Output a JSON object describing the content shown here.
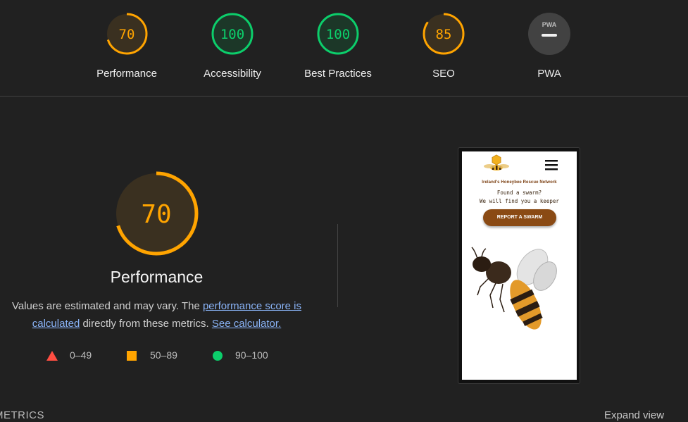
{
  "scores": [
    {
      "key": "performance",
      "value": "70",
      "score": 70,
      "label": "Performance",
      "color": "#ffa400",
      "bg": "#3a3020"
    },
    {
      "key": "accessibility",
      "value": "100",
      "score": 100,
      "label": "Accessibility",
      "color": "#0cce6b",
      "bg": "#1c3728"
    },
    {
      "key": "best_practices",
      "value": "100",
      "score": 100,
      "label": "Best Practices",
      "color": "#0cce6b",
      "bg": "#1c3728"
    },
    {
      "key": "seo",
      "value": "85",
      "score": 85,
      "label": "SEO",
      "color": "#ffa400",
      "bg": "#3a3020"
    },
    {
      "key": "pwa",
      "value": "",
      "score": null,
      "label": "PWA",
      "badge": "PWA",
      "color": "#bdbdbd",
      "bg": "#424242"
    }
  ],
  "performance": {
    "value": "70",
    "score": 70,
    "title": "Performance",
    "desc_prefix": "Values are estimated and may vary. The ",
    "desc_link1": "performance score is calculated",
    "desc_middle": " directly from these metrics. ",
    "desc_link2": "See calculator.",
    "color": "#ffa400"
  },
  "legend": [
    {
      "shape": "triangle",
      "range": "0–49",
      "color": "#ff4e42"
    },
    {
      "shape": "square",
      "range": "50–89",
      "color": "#ffa400"
    },
    {
      "shape": "circle",
      "range": "90–100",
      "color": "#0cce6b"
    }
  ],
  "screenshot": {
    "tagline": "Ireland's Honeybee Rescue Network",
    "line1": "Found a swarm?",
    "line2": "We will find you a keeper",
    "cta": "REPORT A SWARM",
    "brand_color": "#8a4a14",
    "icons": [
      "bee-logo-icon",
      "hamburger-menu-icon",
      "bee-illustration"
    ]
  },
  "footer": {
    "metrics_title": "METRICS",
    "expand_label": "Expand view"
  }
}
